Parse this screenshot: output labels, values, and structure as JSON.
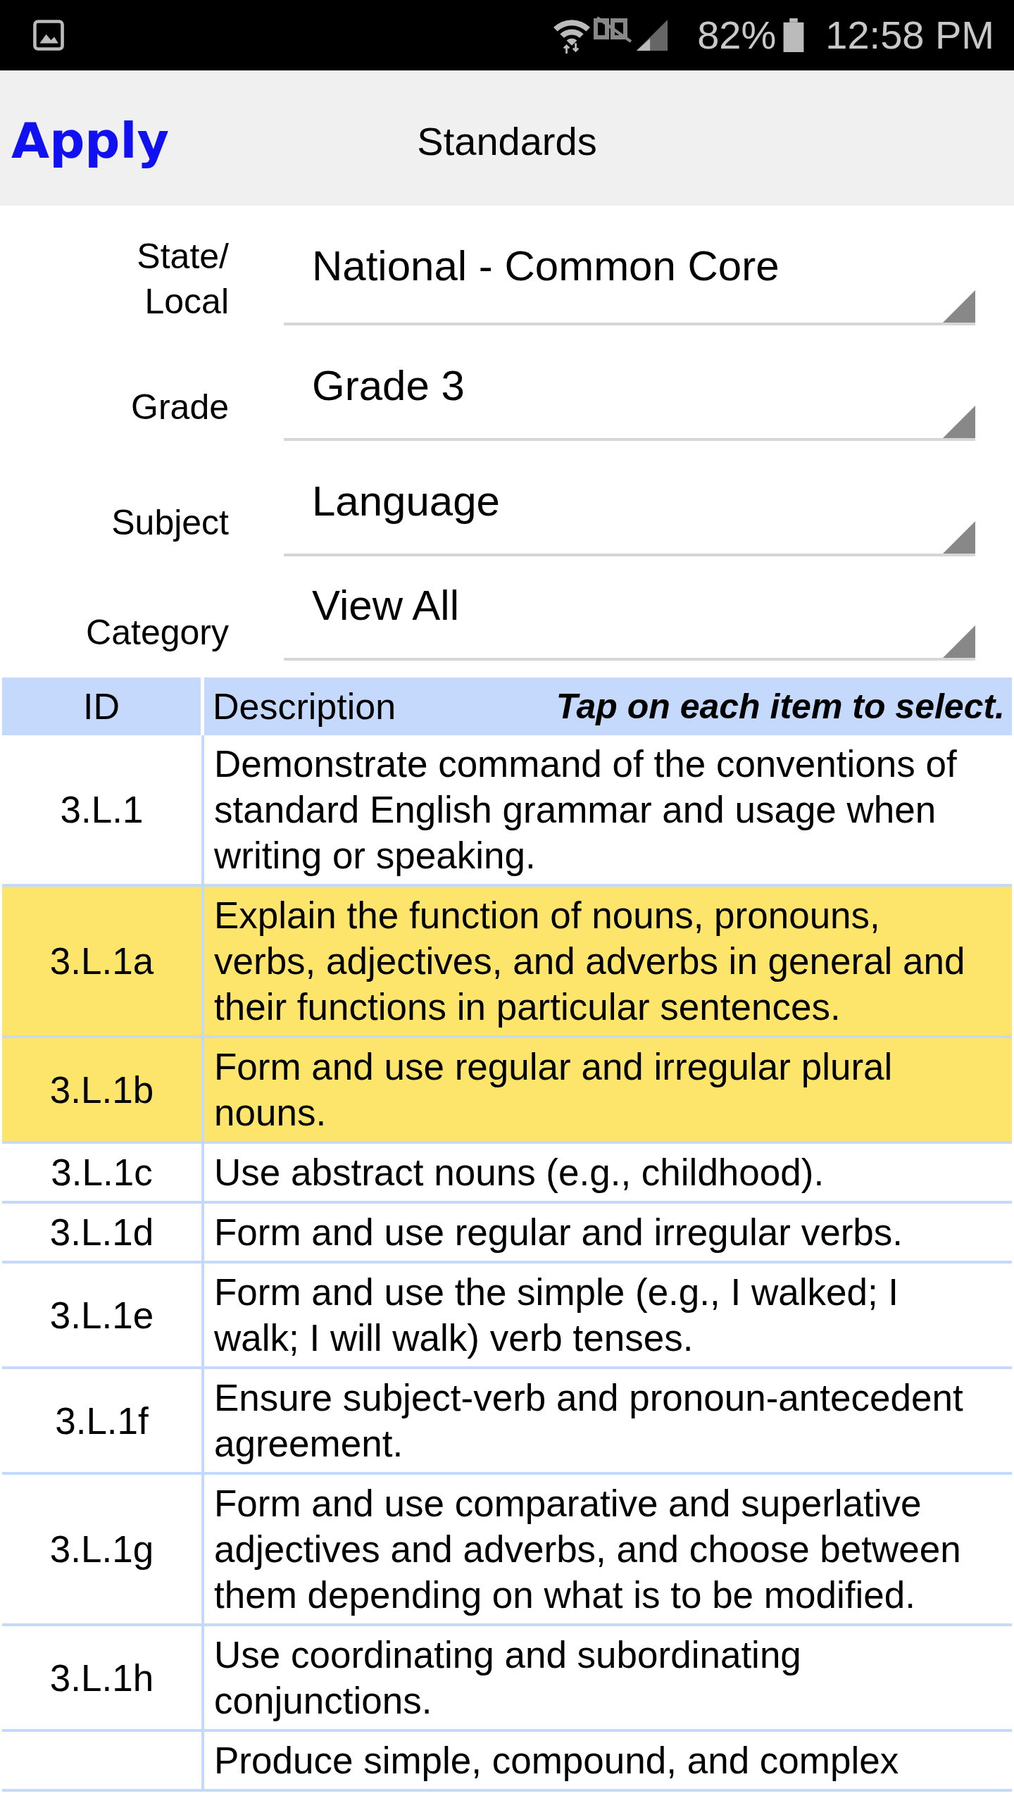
{
  "status_bar": {
    "battery": "82%",
    "time": "12:58 PM"
  },
  "header": {
    "action": "Apply",
    "title": "Standards"
  },
  "filters": [
    {
      "label": "State/ Local",
      "value": "National - Common Core"
    },
    {
      "label": "Grade",
      "value": "Grade 3"
    },
    {
      "label": "Subject",
      "value": "Language"
    },
    {
      "label": "Category",
      "value": "View All"
    }
  ],
  "table": {
    "columns": [
      "ID",
      "Description"
    ],
    "hint": "Tap on each item to select.",
    "rows": [
      {
        "id": "3.L.1",
        "description": "Demonstrate command of the conventions of standard English grammar and usage when writing or speaking.",
        "selected": false
      },
      {
        "id": "3.L.1a",
        "description": "Explain the function of nouns, pronouns, verbs, adjectives, and adverbs in general and their functions in particular sentences.",
        "selected": true
      },
      {
        "id": "3.L.1b",
        "description": "Form and use regular and irregular plural nouns.",
        "selected": true
      },
      {
        "id": "3.L.1c",
        "description": "Use abstract nouns (e.g., childhood).",
        "selected": false
      },
      {
        "id": "3.L.1d",
        "description": "Form and use regular and irregular verbs.",
        "selected": false
      },
      {
        "id": "3.L.1e",
        "description": "Form and use the simple (e.g., I walked; I walk; I will walk) verb tenses.",
        "selected": false
      },
      {
        "id": "3.L.1f",
        "description": "Ensure subject-verb and pronoun-antecedent agreement.",
        "selected": false
      },
      {
        "id": "3.L.1g",
        "description": "Form and use comparative and superlative adjectives and adverbs, and choose between them depending on what is to be modified.",
        "selected": false
      },
      {
        "id": "3.L.1h",
        "description": "Use coordinating and subordinating conjunctions.",
        "selected": false
      },
      {
        "description": "Produce simple, compound, and complex",
        "selected": false
      }
    ]
  }
}
